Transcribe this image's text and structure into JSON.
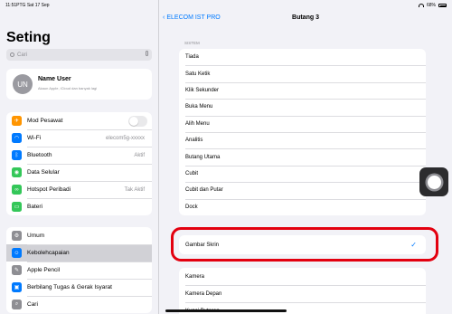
{
  "status": {
    "time": "11:51PTG",
    "date": "Sat 17 Sep",
    "battery": "68%"
  },
  "sidebar": {
    "title": "Seting",
    "search_placeholder": "Cari",
    "user": {
      "initials": "UN",
      "name": "Name User",
      "subtitle": "Akaun Apple, iCloud dan banyak lagi"
    },
    "group1": [
      {
        "label": "Mod Pesawat",
        "icon": "airplane-icon",
        "color": "#ff9500",
        "value": "",
        "toggle": true
      },
      {
        "label": "Wi-Fi",
        "icon": "wifi-icon",
        "color": "#007aff",
        "value": "elecom5g-xxxxx"
      },
      {
        "label": "Bluetooth",
        "icon": "bluetooth-icon",
        "color": "#007aff",
        "value": "Aktif"
      },
      {
        "label": "Data Selular",
        "icon": "cellular-icon",
        "color": "#34c759",
        "value": ""
      },
      {
        "label": "Hotspot Peribadi",
        "icon": "hotspot-icon",
        "color": "#34c759",
        "value": "Tak Aktif"
      },
      {
        "label": "Bateri",
        "icon": "battery-icon",
        "color": "#34c759",
        "value": ""
      }
    ],
    "group2": [
      {
        "label": "Umum",
        "icon": "gear-icon",
        "color": "#8e8e93"
      },
      {
        "label": "Kebolehcapaian",
        "icon": "accessibility-icon",
        "color": "#007aff",
        "selected": true
      },
      {
        "label": "Apple Pencil",
        "icon": "pencil-icon",
        "color": "#8e8e93"
      },
      {
        "label": "Berbilang Tugas & Gerak Isyarat",
        "icon": "multitask-icon",
        "color": "#007aff"
      },
      {
        "label": "Cari",
        "icon": "search-icon",
        "color": "#8e8e93"
      }
    ]
  },
  "detail": {
    "back_label": "ELECOM IST PRO",
    "title": "Butang 3",
    "section": "SISTEM",
    "items": [
      "Tiada",
      "Satu Ketik",
      "Klik Sekunder",
      "Buka Menu",
      "Alih Menu",
      "Analitis",
      "Butang Utama",
      "Cubit",
      "Cubit dan Putar",
      "Dock"
    ],
    "selected_item": "Gambar Skrin",
    "items_after": [
      "Kamera",
      "Kamera Depan",
      "Kunci Putaran"
    ]
  }
}
